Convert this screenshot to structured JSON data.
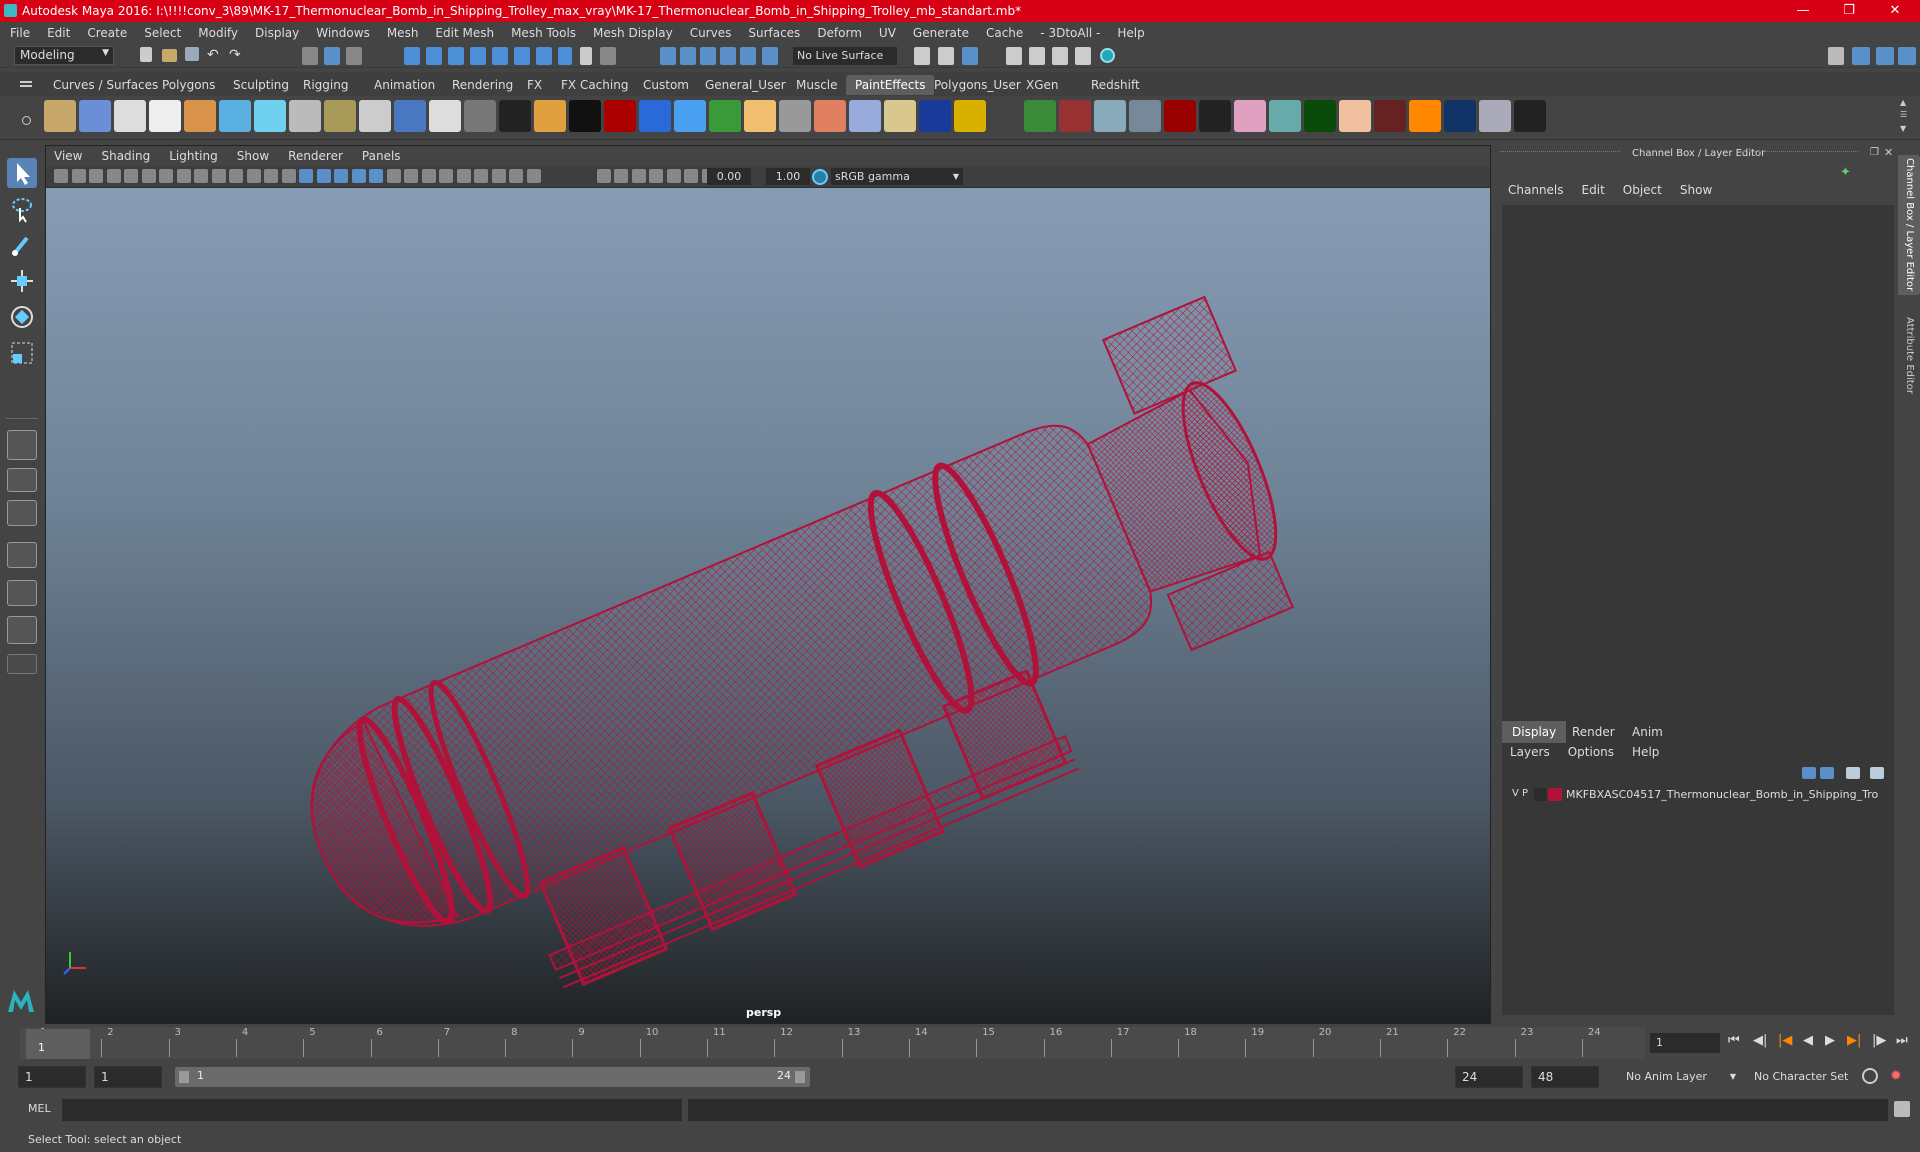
{
  "title": "Autodesk Maya 2016: I:\\!!!!conv_3\\89\\MK-17_Thermonuclear_Bomb_in_Shipping_Trolley_max_vray\\MK-17_Thermonuclear_Bomb_in_Shipping_Trolley_mb_standart.mb*",
  "menu": [
    "File",
    "Edit",
    "Create",
    "Select",
    "Modify",
    "Display",
    "Windows",
    "Mesh",
    "Edit Mesh",
    "Mesh Tools",
    "Mesh Display",
    "Curves",
    "Surfaces",
    "Deform",
    "UV",
    "Generate",
    "Cache",
    "- 3DtoAll -",
    "Help"
  ],
  "status": {
    "mode": "Modeling",
    "live_surface": "No Live Surface"
  },
  "shelf_tabs": [
    "Curves / Surfaces",
    "Polygons",
    "Sculpting",
    "Rigging",
    "Animation",
    "Rendering",
    "FX",
    "FX Caching",
    "Custom",
    "General_User",
    "Muscle",
    "PaintEffects",
    "Polygons_User",
    "XGen",
    "Redshift"
  ],
  "active_shelf": "PaintEffects",
  "viewport": {
    "menu": [
      "View",
      "Shading",
      "Lighting",
      "Show",
      "Renderer",
      "Panels"
    ],
    "exposure": "0.00",
    "gamma": "1.00",
    "color_space": "sRGB gamma",
    "camera": "persp"
  },
  "channel_box": {
    "title": "Channel Box / Layer Editor",
    "menu": [
      "Channels",
      "Edit",
      "Object",
      "Show"
    ],
    "side_tabs": [
      "Channel Box / Layer Editor",
      "Attribute Editor"
    ]
  },
  "layer_editor": {
    "tabs": [
      "Display",
      "Render",
      "Anim"
    ],
    "menu": [
      "Layers",
      "Options",
      "Help"
    ],
    "layer": {
      "v": "V",
      "p": "P",
      "color": "#b0123a",
      "name": "MKFBXASC04517_Thermonuclear_Bomb_in_Shipping_Tro"
    }
  },
  "timeline": {
    "ticks": [
      "1",
      "2",
      "3",
      "4",
      "5",
      "6",
      "7",
      "8",
      "9",
      "10",
      "11",
      "12",
      "13",
      "14",
      "15",
      "16",
      "17",
      "18",
      "19",
      "20",
      "21",
      "22",
      "23",
      "24"
    ],
    "current": "1",
    "current_field": "1"
  },
  "range": {
    "start": "1",
    "start_inner": "1",
    "slider_start": "1",
    "slider_end": "24",
    "end": "24",
    "end_outer": "48",
    "anim_layer": "No Anim Layer",
    "char_set": "No Character Set"
  },
  "command": {
    "label": "MEL"
  },
  "help_line": "Select Tool: select an object",
  "colors": {
    "title_bar": "#d70015",
    "wire": "#b0123a"
  }
}
